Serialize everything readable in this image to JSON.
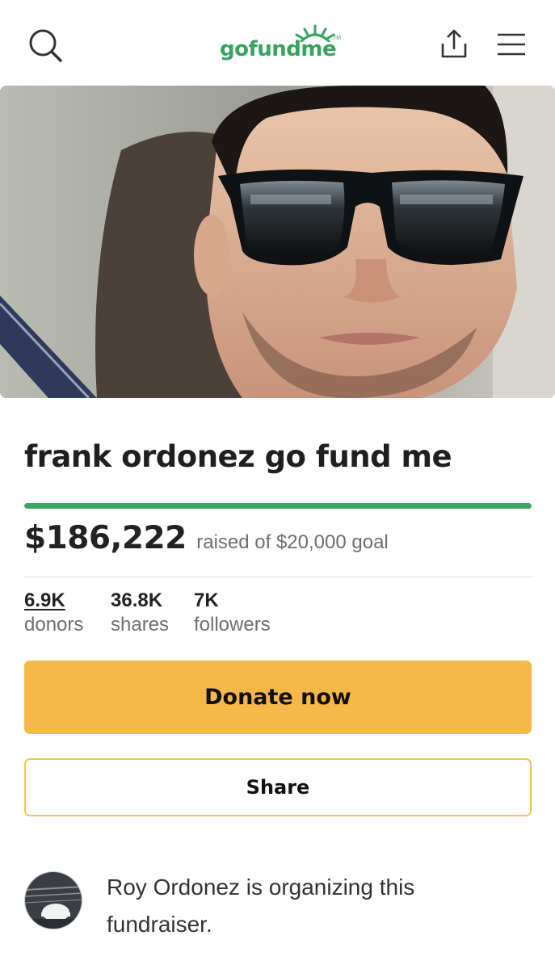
{
  "header": {
    "logo_text": "gofundme",
    "logo_tm": "TM",
    "search_icon": "search-icon",
    "share_icon": "share-upload-icon",
    "menu_icon": "hamburger-menu-icon"
  },
  "hero": {
    "image": "photo of a man wearing black sunglasses in a car seat"
  },
  "campaign": {
    "title": "frank ordonez go fund me",
    "amount_raised": "$186,222",
    "goal_text": "raised of $20,000 goal",
    "progress_percent": 100
  },
  "stats": [
    {
      "value": "6.9K",
      "label": "donors"
    },
    {
      "value": "36.8K",
      "label": "shares"
    },
    {
      "value": "7K",
      "label": "followers"
    }
  ],
  "actions": {
    "donate_label": "Donate now",
    "share_label": "Share"
  },
  "organizer": {
    "text": "Roy Ordonez is organizing this fundraiser."
  },
  "colors": {
    "brand_green": "#36a35e",
    "progress_green": "#3aa764",
    "donate_yellow": "#f7b84a",
    "share_border": "#f0c457"
  }
}
